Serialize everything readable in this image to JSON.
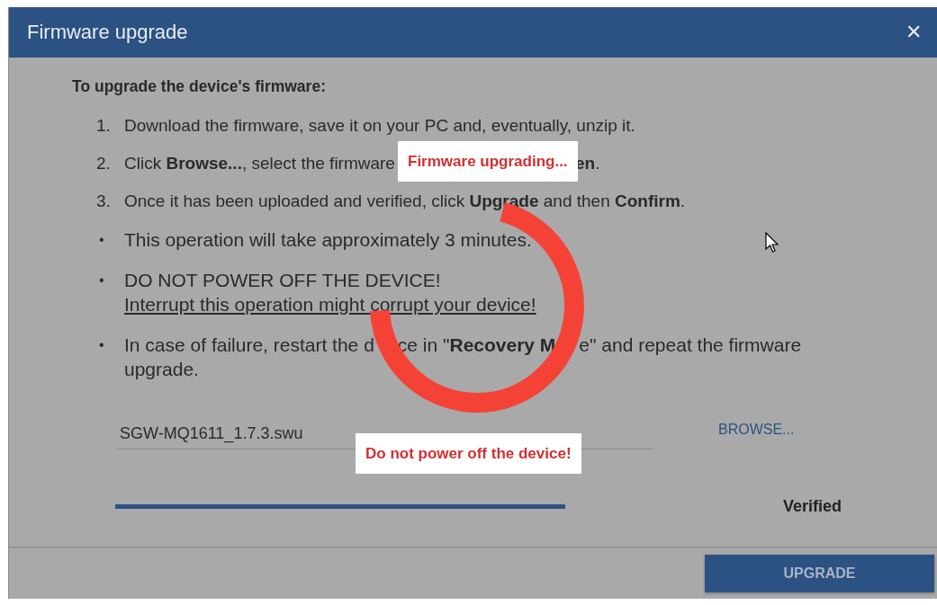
{
  "dialog": {
    "title": "Firmware upgrade",
    "close": "✕"
  },
  "instructions": {
    "heading": "To upgrade the device's firmware:",
    "items": [
      {
        "kind": "numbered",
        "marker": "1.",
        "lines": [
          [
            "Download the firmware, save it on your PC and, eventually, unzip it."
          ]
        ]
      },
      {
        "kind": "numbered",
        "marker": "2.",
        "lines": [
          [
            "Click **Browse...**, select the firmware",
            "**en**."
          ]
        ]
      },
      {
        "kind": "numbered",
        "marker": "3.",
        "lines": [
          [
            "Once it has been uploaded and verified, click **Upgrade** and then **Confirm**."
          ]
        ]
      },
      {
        "kind": "bullet",
        "marker": "•",
        "lines": [
          [
            "This operation will take approximately 3 minutes."
          ]
        ]
      },
      {
        "kind": "bullet",
        "marker": "•",
        "lines": [
          [
            "DO NOT POWER OFF THE DEVICE!"
          ]
        ],
        "link": "Interrupt this operation might corrupt your device!"
      },
      {
        "kind": "bullet",
        "marker": "•",
        "lines": [
          [
            "In case of failure, restart the d",
            "ce in \"**Recovery M**",
            "e\" and repeat the firmware"
          ],
          [
            "upgrade."
          ]
        ]
      }
    ]
  },
  "file": {
    "value": "SGW-MQ1611_1.7.3.swu",
    "browse": "BROWSE..."
  },
  "progress": {
    "level": 1,
    "status": "Verified"
  },
  "overlay": {
    "top_message": "Firmware upgrading...",
    "bottom_message": "Do not power off the device!"
  },
  "footer": {
    "button": "UPGRADE"
  }
}
